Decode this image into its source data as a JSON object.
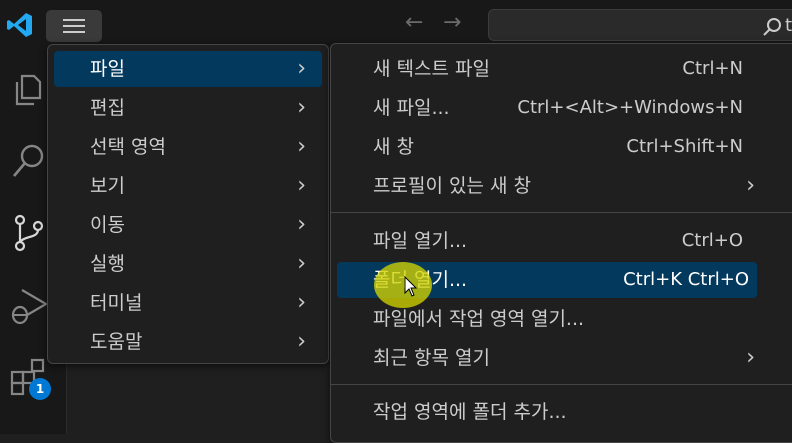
{
  "titlebar": {
    "search_text": "t",
    "nav_back": "←",
    "nav_forward": "→"
  },
  "activity_bar": {
    "icons": [
      "explorer-icon",
      "search-icon",
      "source-control-icon",
      "run-debug-icon",
      "extensions-icon"
    ],
    "extensions_badge": "1"
  },
  "main_menu": {
    "items": [
      {
        "label": "파일",
        "active": true
      },
      {
        "label": "편집"
      },
      {
        "label": "선택 영역"
      },
      {
        "label": "보기"
      },
      {
        "label": "이동"
      },
      {
        "label": "실행"
      },
      {
        "label": "터미널"
      },
      {
        "label": "도움말"
      }
    ]
  },
  "file_menu": {
    "items": [
      {
        "label": "새 텍스트 파일",
        "shortcut": "Ctrl+N"
      },
      {
        "label": "새 파일...",
        "shortcut": "Ctrl+<Alt>+Windows+N"
      },
      {
        "label": "새 창",
        "shortcut": "Ctrl+Shift+N"
      },
      {
        "label": "프로필이 있는 새 창",
        "shortcut": ""
      },
      {
        "label": "파일 열기...",
        "shortcut": "Ctrl+O"
      },
      {
        "label": "폴더 열기...",
        "shortcut": "Ctrl+K Ctrl+O",
        "active": true
      },
      {
        "label": "파일에서 작업 영역 열기...",
        "shortcut": ""
      },
      {
        "label": "최근 항목 열기",
        "shortcut": ""
      },
      {
        "label": "작업 영역에 폴더 추가...",
        "shortcut": ""
      }
    ]
  },
  "colors": {
    "accent": "#0078d4",
    "highlight": "#04395e",
    "background": "#1f1f1f"
  }
}
